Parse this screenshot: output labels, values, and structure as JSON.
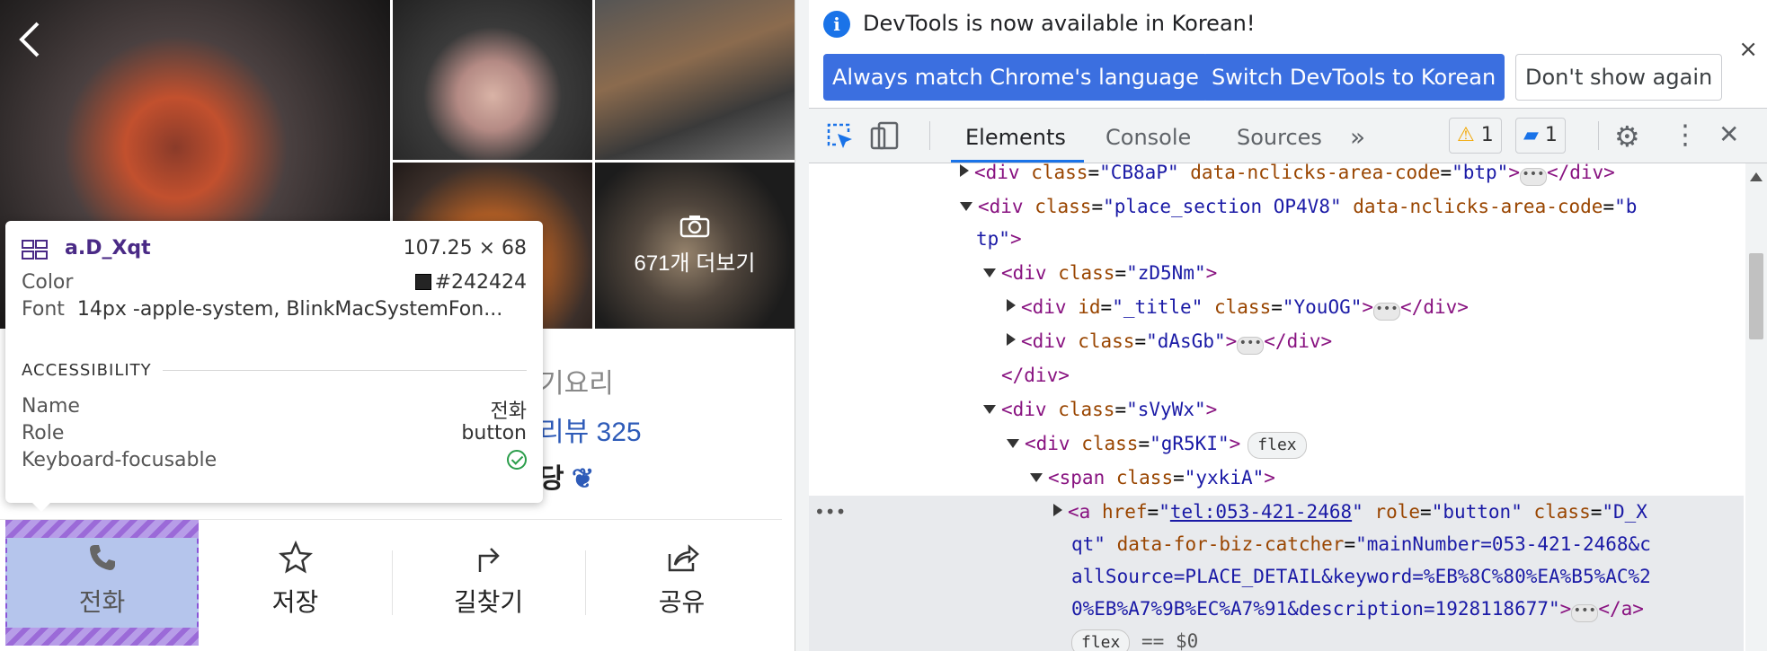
{
  "place": {
    "photos_more": "671개 더보기",
    "avatar_badge": "my",
    "category": "기요리",
    "review": "리뷰 325",
    "award": "당"
  },
  "actions": [
    {
      "label": "전화",
      "icon": "phone-icon"
    },
    {
      "label": "저장",
      "icon": "star-icon"
    },
    {
      "label": "길찾기",
      "icon": "directions-icon"
    },
    {
      "label": "공유",
      "icon": "share-icon"
    }
  ],
  "tooltip": {
    "selector": "a.D_Xqt",
    "dimensions": "107.25 × 68",
    "color_label": "Color",
    "color_value": "#242424",
    "font_label": "Font",
    "font_value": "14px -apple-system, BlinkMacSystemFon...",
    "section": "ACCESSIBILITY",
    "name_label": "Name",
    "name_value": "전화",
    "role_label": "Role",
    "role_value": "button",
    "kf_label": "Keyboard-focusable"
  },
  "devtools": {
    "banner": {
      "message": "DevTools is now available in Korean!",
      "btn_match": "Always match Chrome's language",
      "btn_switch": "Switch DevTools to Korean",
      "btn_dont": "Don't show again",
      "close": "×"
    },
    "tabs": [
      "Elements",
      "Console",
      "Sources"
    ],
    "more_tabs": "»",
    "warnings": "1",
    "messages": "1",
    "close": "✕",
    "tree": {
      "l1": {
        "tag_open": "<div",
        "a1": "class",
        "v1": "\"CB8aP\"",
        "a2": "data-nclicks-area-code",
        "v2": "\"btp\"",
        "tag_end": ">",
        "close": "</div>"
      },
      "l2": {
        "tag_open": "<div",
        "a1": "class",
        "v1": "\"place_section OP4V8\"",
        "a2": "data-nclicks-area-code",
        "v2": "\"b"
      },
      "l2b": {
        "v": "tp\"",
        "end": ">"
      },
      "l3": {
        "tag": "<div",
        "a1": "class",
        "v1": "\"zD5Nm\"",
        "end": ">"
      },
      "l4": {
        "tag": "<div",
        "a1": "id",
        "v1": "\"_title\"",
        "a2": "class",
        "v2": "\"YouOG\"",
        "end": ">",
        "close": "</div>"
      },
      "l5": {
        "tag": "<div",
        "a1": "class",
        "v1": "\"dAsGb\"",
        "end": ">",
        "close": "</div>"
      },
      "l6": {
        "close": "</div>"
      },
      "l7": {
        "tag": "<div",
        "a1": "class",
        "v1": "\"sVyWx\"",
        "end": ">"
      },
      "l8": {
        "tag": "<div",
        "a1": "class",
        "v1": "\"gR5KI\"",
        "end": ">",
        "pill": "flex"
      },
      "l9": {
        "tag": "<span",
        "a1": "class",
        "v1": "\"yxkiA\"",
        "end": ">"
      },
      "l10": {
        "tag": "<a",
        "a1": "href",
        "v1q1": "\"",
        "href": "tel:053-421-2468",
        "v1q2": "\"",
        "a2": "role",
        "v2": "\"button\"",
        "a3": "class",
        "v3": "\"D_X"
      },
      "l11": {
        "v": "qt\"",
        "a": "data-for-biz-catcher",
        "v2": "\"mainNumber=053-421-2468&c"
      },
      "l12": {
        "v": "allSource=PLACE_DETAIL&keyword=%EB%8C%80%EA%B5%AC%2"
      },
      "l13": {
        "v": "0%EB%A7%9B%EC%A7%91&description=1928118677\"",
        "end": ">",
        "close": "</a>"
      },
      "l14": {
        "pill": "flex",
        "eq": "== $0"
      }
    }
  }
}
